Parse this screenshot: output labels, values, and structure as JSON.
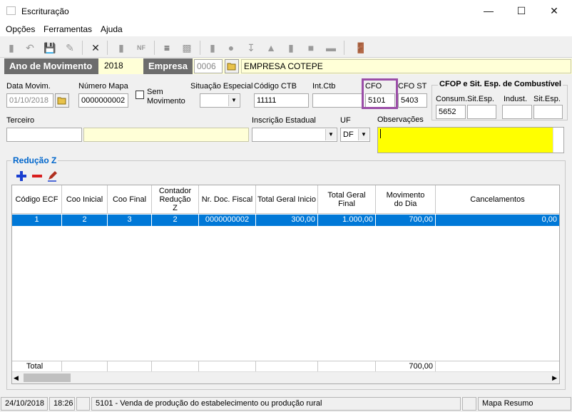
{
  "window": {
    "title": "Escrituração"
  },
  "menu": [
    {
      "label": "Opções"
    },
    {
      "label": "Ferramentas"
    },
    {
      "label": "Ajuda"
    }
  ],
  "header": {
    "ano_label": "Ano de Movimento",
    "ano_value": "2018",
    "empresa_label": "Empresa",
    "empresa_code": "0006",
    "empresa_name": "EMPRESA COTEPE"
  },
  "form": {
    "data_movim": {
      "label": "Data Movim.",
      "value": "01/10/2018"
    },
    "numero_mapa": {
      "label": "Número Mapa",
      "value": "0000000002"
    },
    "sem_movimento": {
      "label": "Sem Movimento",
      "checked": false
    },
    "situacao_especial": {
      "label": "Situação Especial",
      "value": ""
    },
    "codigo_ctb": {
      "label": "Código CTB",
      "value": "11111"
    },
    "int_ctb": {
      "label": "Int.Ctb",
      "value": ""
    },
    "cfo": {
      "label": "CFO",
      "value": "5101"
    },
    "cfo_st": {
      "label": "CFO ST",
      "value": "5403"
    },
    "cfop_group": {
      "title": "CFOP e Sit. Esp. de Combustível",
      "consum_label": "Consum.",
      "consum_value": "5652",
      "sit_esp1_label": "Sit.Esp.",
      "sit_esp1_value": "",
      "indust_label": "Indust.",
      "indust_value": "",
      "sit_esp2_label": "Sit.Esp.",
      "sit_esp2_value": ""
    },
    "terceiro": {
      "label": "Terceiro",
      "code": "",
      "name": ""
    },
    "inscricao_estadual": {
      "label": "Inscrição Estadual",
      "value": ""
    },
    "uf": {
      "label": "UF",
      "value": "DF"
    },
    "observacoes": {
      "label": "Observações",
      "value": ""
    }
  },
  "reducao_z": {
    "title": "Redução Z",
    "columns": [
      "Código ECF",
      "Coo Inicial",
      "Coo Final",
      "Contador Redução Z",
      "Nr. Doc. Fiscal",
      "Total Geral Inicio",
      "Total Geral Final",
      "Movimento do Dia",
      "Cancelamentos"
    ],
    "rows": [
      [
        "1",
        "2",
        "3",
        "2",
        "0000000002",
        "300,00",
        "1.000,00",
        "700,00",
        "0,00"
      ]
    ],
    "footer": {
      "label": "Total",
      "movimento_total": "700,00"
    }
  },
  "statusbar": {
    "date": "24/10/2018",
    "time": "18:26",
    "message": "5101 - Venda de produção do estabelecimento ou produção rural",
    "screen": "Mapa Resumo"
  },
  "colors": {
    "accent": "#0078d7",
    "highlight_box": "#9b4ea8",
    "yellow_field": "#ffff00"
  }
}
